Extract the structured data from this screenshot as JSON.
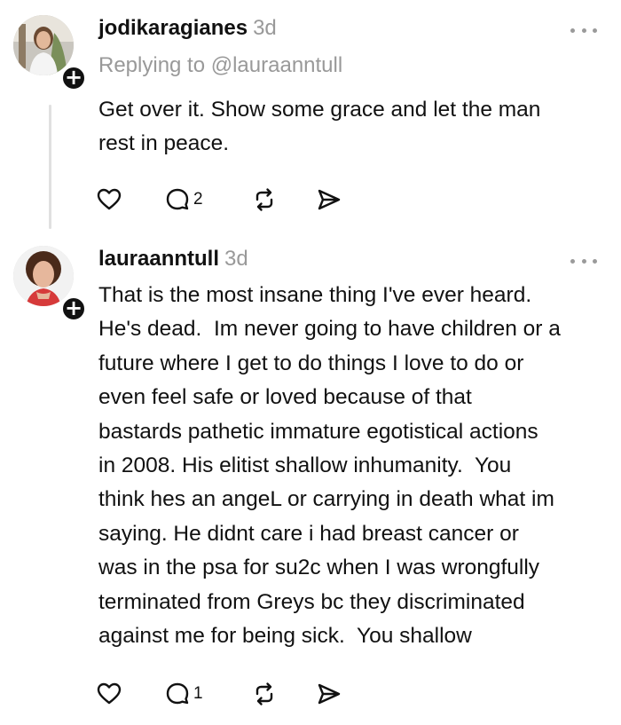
{
  "posts": [
    {
      "username": "jodikaragianes",
      "time": "3d",
      "replying_to": "Replying to @lauraanntull",
      "text": "Get over it. Show some grace and let the man\nrest in peace.",
      "follow_symbol": "+",
      "more_icon": "more-icon",
      "actions": {
        "like_icon": "heart-icon",
        "reply_icon": "comment-icon",
        "reply_count": "2",
        "repost_icon": "repost-icon",
        "share_icon": "share-icon"
      }
    },
    {
      "username": "lauraanntull",
      "time": "3d",
      "text": "That is the most insane thing I've ever heard.\nHe's dead.  Im never going to have children or a\nfuture where I get to do things I love to do or\neven feel safe or loved because of that\nbastards pathetic immature egotistical actions\nin 2008. His elitist shallow inhumanity.  You\nthink hes an angeL or carrying in death what im\nsaying. He didnt care i had breast cancer or\nwas in the psa for su2c when I was wrongfully\nterminated from Greys bc they discriminated\nagainst me for being sick.  You shallow",
      "follow_symbol": "+",
      "more_icon": "more-icon",
      "actions": {
        "like_icon": "heart-icon",
        "reply_icon": "comment-icon",
        "reply_count": "1",
        "repost_icon": "repost-icon",
        "share_icon": "share-icon"
      }
    }
  ]
}
